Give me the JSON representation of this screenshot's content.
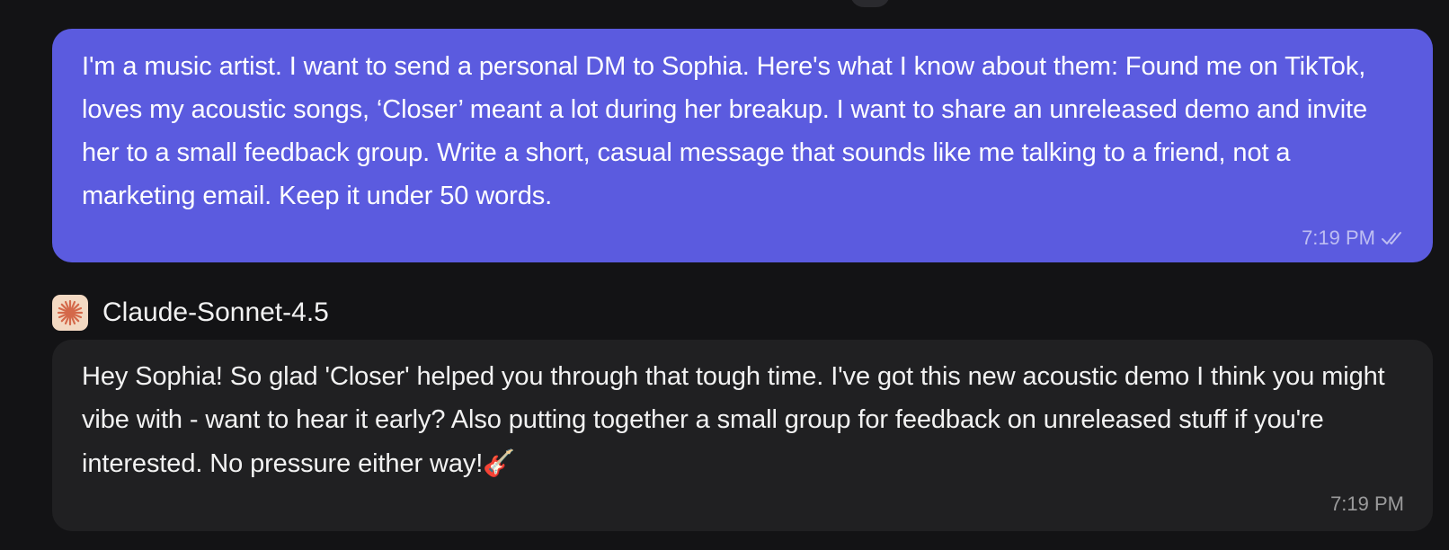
{
  "user_message": {
    "text": "I'm a music artist. I want to send a personal DM to Sophia. Here's what I know about them: Found me on TikTok, loves my acoustic songs, ‘Closer’ meant a lot during her breakup. I want to share an unreleased demo and invite her to a small feedback group. Write a short, casual message that sounds like me talking to a friend, not a marketing email. Keep it under 50 words.",
    "time": "7:19 PM",
    "status_icon": "double-check-icon",
    "bubble_color": "#5b5bdf"
  },
  "bot": {
    "name": "Claude-Sonnet-4.5",
    "avatar_icon": "claude-starburst-icon",
    "avatar_bg": "#f3d9c2",
    "avatar_color": "#d4694a"
  },
  "bot_message": {
    "text": "Hey Sophia! So glad 'Closer' helped you through that tough time. I've got this new acoustic demo I think you might vibe with - want to hear it early? Also putting together a small group for feedback on unreleased stuff if you're interested. No pressure either way!",
    "emoji": "🎸",
    "time": "7:19 PM",
    "bubble_color": "#202022"
  },
  "background_color": "#131315"
}
